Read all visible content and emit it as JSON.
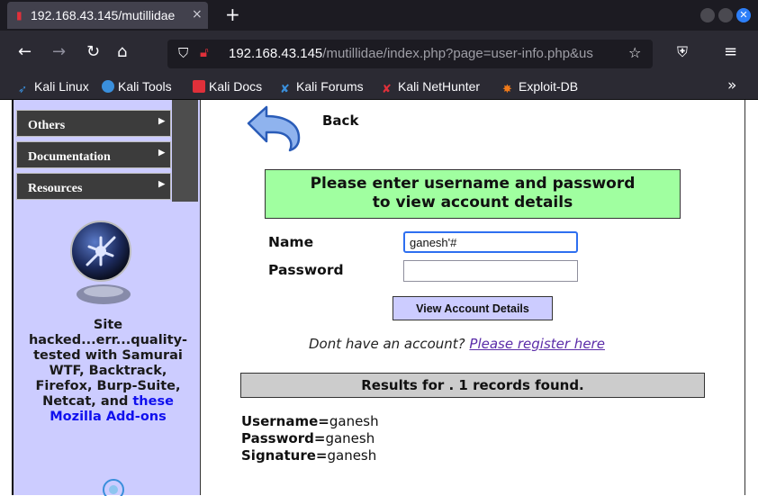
{
  "browser": {
    "tab_title": "192.168.43.145/mutillidae",
    "tab_close": "×",
    "new_tab": "+",
    "url_host": "192.168.43.145",
    "url_path": "/mutillidae/index.php?page=user-info.php&us",
    "bookmarks": [
      {
        "label": "Kali Linux",
        "icon": "kali-dragon-icon",
        "color": "#3a8fdc"
      },
      {
        "label": "Kali Tools",
        "icon": "kali-tools-icon",
        "color": "#e0303a"
      },
      {
        "label": "Kali Docs",
        "icon": "kali-docs-icon",
        "color": "#e0303a"
      },
      {
        "label": "Kali Forums",
        "icon": "kali-forums-icon",
        "color": "#3a8fdc"
      },
      {
        "label": "Kali NetHunter",
        "icon": "nethunter-icon",
        "color": "#e0303a"
      },
      {
        "label": "Exploit-DB",
        "icon": "exploit-db-icon",
        "color": "#f07a1a"
      }
    ],
    "more": "»"
  },
  "sidebar": {
    "menu": [
      {
        "label": "Others",
        "arrow": "▶"
      },
      {
        "label": "Documentation",
        "arrow": "▶"
      },
      {
        "label": "Resources",
        "arrow": "▶"
      }
    ],
    "site_line1": "Site",
    "site_line2": "hacked...err...quality-",
    "site_line3": "tested with Samurai",
    "site_line4": "WTF, Backtrack,",
    "site_line5": "Firefox, Burp-Suite,",
    "site_line6_pre": "Netcat, and ",
    "site_line6_link": "these",
    "site_line7": "Mozilla Add-ons"
  },
  "main": {
    "back_label": "Back",
    "banner_line1": "Please enter username and password",
    "banner_line2": "to view account details",
    "name_label": "Name",
    "name_value": "ganesh'#",
    "password_label": "Password",
    "password_value": "",
    "view_button": "View Account Details",
    "register_text": "Dont have an account? ",
    "register_link": "Please register here",
    "results_header": "Results for . 1 records found.",
    "records": [
      {
        "key": "Username=",
        "value": "ganesh"
      },
      {
        "key": "Password=",
        "value": "ganesh"
      },
      {
        "key": "Signature=",
        "value": "ganesh"
      }
    ]
  },
  "colors": {
    "banner_bg": "#a0ffa0",
    "sidebar_bg": "#ccccff",
    "results_bg": "#cccccc"
  }
}
